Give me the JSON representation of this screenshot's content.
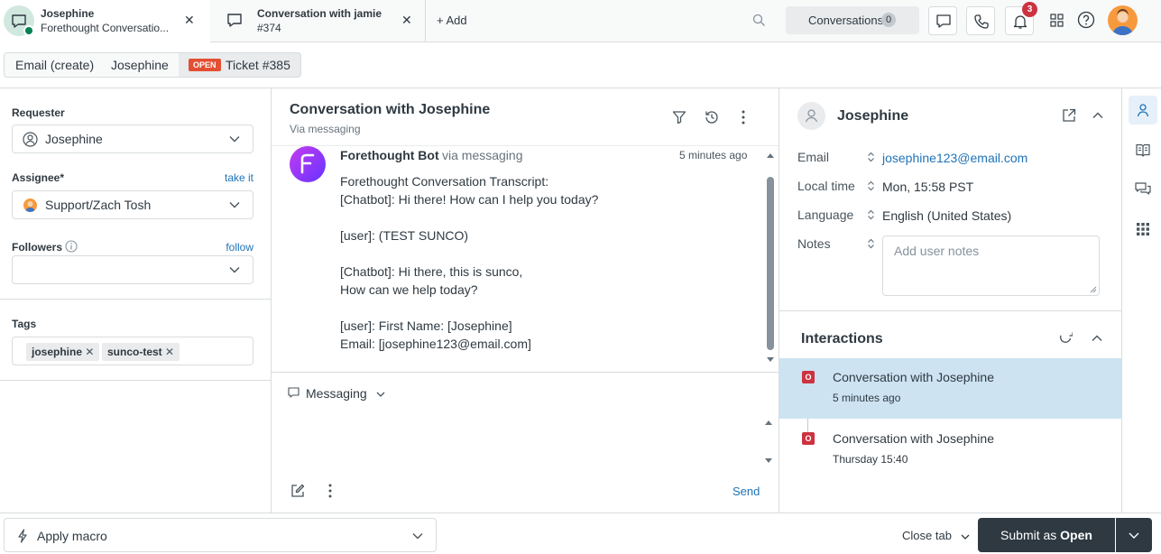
{
  "tabs": [
    {
      "title": "Josephine",
      "subtitle": "Forethought Conversatio..."
    },
    {
      "title": "Conversation with jamie",
      "subtitle": "#374"
    }
  ],
  "add_label": "Add",
  "conversations": {
    "label": "Conversations",
    "count": "0"
  },
  "notifications_count": "3",
  "breadcrumbs": {
    "email": "Email (create)",
    "user": "Josephine",
    "status": "OPEN",
    "ticket": "Ticket #385"
  },
  "left": {
    "requester_label": "Requester",
    "requester_value": "Josephine",
    "assignee_label": "Assignee*",
    "assignee_link": "take it",
    "assignee_value": "Support/Zach Tosh",
    "followers_label": "Followers",
    "followers_link": "follow",
    "tags_label": "Tags",
    "tags": [
      "josephine",
      "sunco-test"
    ]
  },
  "conversation": {
    "title": "Conversation with Josephine",
    "subtitle": "Via messaging",
    "sender": "Forethought Bot",
    "via": "via messaging",
    "time": "5 minutes ago",
    "lines": [
      "Forethought Conversation Transcript:",
      "[Chatbot]: Hi there! How can I help you today?",
      "",
      "[user]: (TEST SUNCO)",
      "",
      "[Chatbot]: Hi there, this is sunco,",
      "How can we help today?",
      "",
      "[user]: First Name: [Josephine]",
      "Email: [josephine123@email.com]"
    ],
    "composer_channel": "Messaging",
    "send_label": "Send"
  },
  "profile": {
    "name": "Josephine",
    "email_label": "Email",
    "email": "josephine123@email.com",
    "local_time_label": "Local time",
    "local_time": "Mon, 15:58 PST",
    "language_label": "Language",
    "language": "English (United States)",
    "notes_label": "Notes",
    "notes_placeholder": "Add user notes"
  },
  "interactions": {
    "title": "Interactions",
    "items": [
      {
        "badge": "O",
        "title": "Conversation with Josephine",
        "time": "5 minutes ago"
      },
      {
        "badge": "O",
        "title": "Conversation with Josephine",
        "time": "Thursday 15:40"
      }
    ]
  },
  "bottom": {
    "macro": "Apply macro",
    "close_tab": "Close tab",
    "submit_prefix": "Submit as",
    "submit_status": "Open"
  },
  "colors": {
    "accent": "#1f73b7",
    "submit_bg": "#2f3941",
    "open_badge": "#cc3340",
    "selected_row": "#cde3f2",
    "brand_bot": "#9933ff"
  }
}
